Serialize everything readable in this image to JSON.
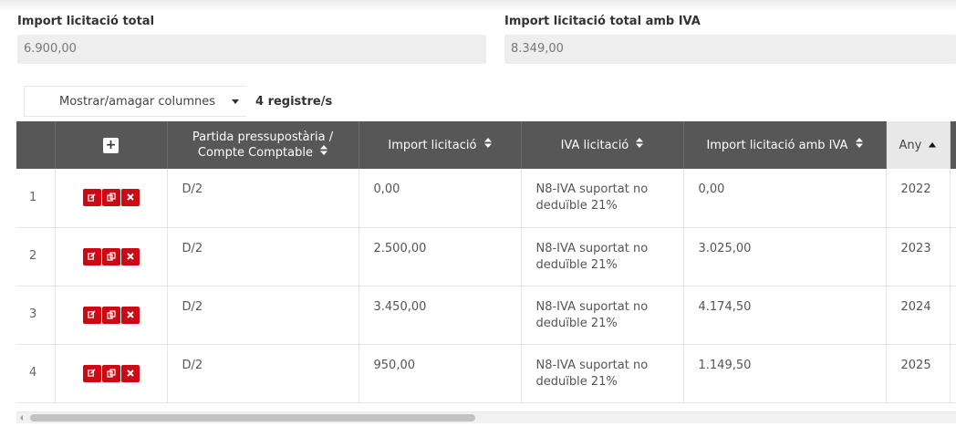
{
  "summary": {
    "total_label": "Import licitació total",
    "total_value": "6.900,00",
    "total_iva_label": "Import licitació total amb IVA",
    "total_iva_value": "8.349,00"
  },
  "toolbar": {
    "columns_label": "Mostrar/amagar columnes",
    "record_count": "4 registre/s"
  },
  "table": {
    "add_label": "+",
    "headers": {
      "partida_line1": "Partida pressupostària /",
      "partida_line2": "Compte Comptable",
      "import": "Import licitació",
      "iva": "IVA licitació",
      "import_iva": "Import licitació amb IVA",
      "any": "Any"
    },
    "rows": [
      {
        "num": "1",
        "partida": "D/2",
        "import": "0,00",
        "iva_line1": "N8-IVA suportat no",
        "iva_line2": "deduïble 21%",
        "import_iva": "0,00",
        "any": "2022"
      },
      {
        "num": "2",
        "partida": "D/2",
        "import": "2.500,00",
        "iva_line1": "N8-IVA suportat no",
        "iva_line2": "deduïble 21%",
        "import_iva": "3.025,00",
        "any": "2023"
      },
      {
        "num": "3",
        "partida": "D/2",
        "import": "3.450,00",
        "iva_line1": "N8-IVA suportat no",
        "iva_line2": "deduïble 21%",
        "import_iva": "4.174,50",
        "any": "2024"
      },
      {
        "num": "4",
        "partida": "D/2",
        "import": "950,00",
        "iva_line1": "N8-IVA suportat no",
        "iva_line2": "deduïble 21%",
        "import_iva": "1.149,50",
        "any": "2025"
      }
    ]
  },
  "icons": {
    "edit": "edit-icon",
    "copy": "copy-icon",
    "delete": "delete-icon",
    "sort_both": "sort-both-icon",
    "sort_asc": "sort-asc-icon"
  },
  "colors": {
    "action_red": "#cc0a15",
    "header_dark": "#575757"
  },
  "scrollbar": {
    "position_fraction": 0.48
  }
}
